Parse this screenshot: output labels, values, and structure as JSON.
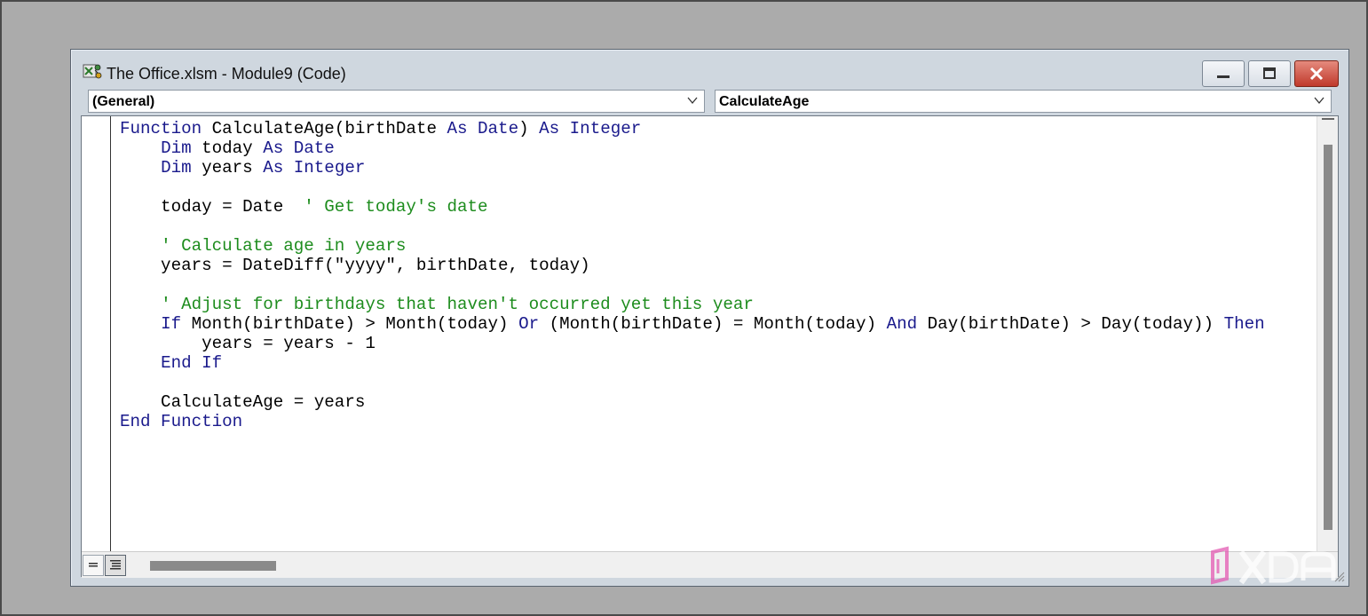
{
  "window": {
    "title": "The Office.xlsm - Module9 (Code)"
  },
  "toolbar": {
    "object_combo": "(General)",
    "procedure_combo": "CalculateAge"
  },
  "code_lines": [
    [
      {
        "t": "Function ",
        "c": "kw"
      },
      {
        "t": "CalculateAge(birthDate ",
        "c": ""
      },
      {
        "t": "As Date",
        "c": "kw"
      },
      {
        "t": ") ",
        "c": ""
      },
      {
        "t": "As Integer",
        "c": "kw"
      }
    ],
    [
      {
        "t": "    ",
        "c": ""
      },
      {
        "t": "Dim ",
        "c": "kw"
      },
      {
        "t": "today ",
        "c": ""
      },
      {
        "t": "As Date",
        "c": "kw"
      }
    ],
    [
      {
        "t": "    ",
        "c": ""
      },
      {
        "t": "Dim ",
        "c": "kw"
      },
      {
        "t": "years ",
        "c": ""
      },
      {
        "t": "As Integer",
        "c": "kw"
      }
    ],
    [],
    [
      {
        "t": "    today = Date  ",
        "c": ""
      },
      {
        "t": "' Get today's date",
        "c": "cm"
      }
    ],
    [],
    [
      {
        "t": "    ",
        "c": ""
      },
      {
        "t": "' Calculate age in years",
        "c": "cm"
      }
    ],
    [
      {
        "t": "    years = DateDiff(\"yyyy\", birthDate, today)",
        "c": ""
      }
    ],
    [],
    [
      {
        "t": "    ",
        "c": ""
      },
      {
        "t": "' Adjust for birthdays that haven't occurred yet this year",
        "c": "cm"
      }
    ],
    [
      {
        "t": "    ",
        "c": ""
      },
      {
        "t": "If ",
        "c": "kw"
      },
      {
        "t": "Month(birthDate) > Month(today) ",
        "c": ""
      },
      {
        "t": "Or ",
        "c": "kw"
      },
      {
        "t": "(Month(birthDate) = Month(today) ",
        "c": ""
      },
      {
        "t": "And ",
        "c": "kw"
      },
      {
        "t": "Day(birthDate) > Day(today)) ",
        "c": ""
      },
      {
        "t": "Then",
        "c": "kw"
      }
    ],
    [
      {
        "t": "        years = years - 1",
        "c": ""
      }
    ],
    [
      {
        "t": "    ",
        "c": ""
      },
      {
        "t": "End If",
        "c": "kw"
      }
    ],
    [],
    [
      {
        "t": "    CalculateAge = years",
        "c": ""
      }
    ],
    [
      {
        "t": "End Function",
        "c": "kw"
      }
    ]
  ],
  "icons": {
    "app": "vba-module-icon",
    "minimize": "minimize-icon",
    "maximize": "maximize-icon",
    "close": "close-icon",
    "dropdown": "chevron-down-icon",
    "procedure_view": "procedure-view-icon",
    "full_module_view": "full-module-view-icon"
  },
  "colors": {
    "keyword": "#1a1a8c",
    "comment": "#1d8c1d",
    "window_frame": "#cfd7df",
    "desktop": "#ababab",
    "close_button": "#c0392b"
  },
  "watermark": {
    "text": "XDA"
  }
}
